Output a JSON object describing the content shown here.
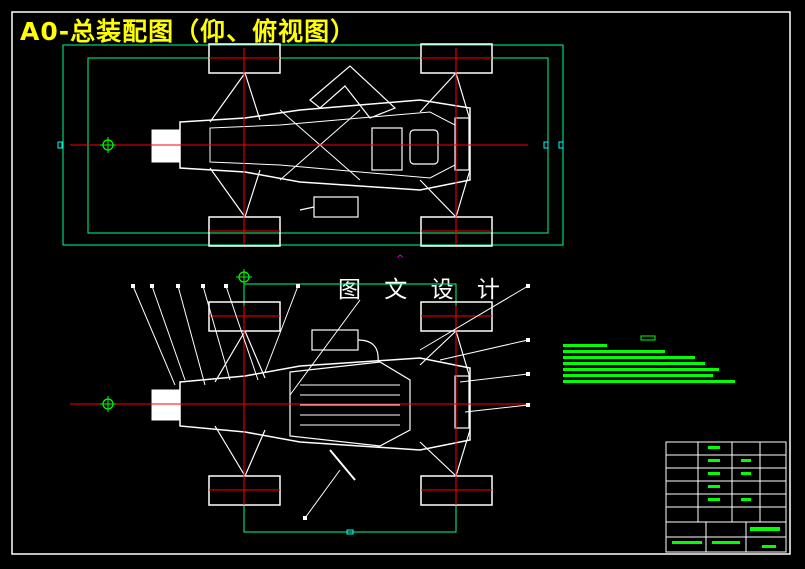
{
  "drawing": {
    "title": "A0-总装配图（仰、俯视图）",
    "watermark": "图 文 设 计",
    "colors": {
      "background": "#000000",
      "frame": "#ffffff",
      "outline": "#00ff00",
      "centerline": "#ff0000",
      "title": "#ffff00",
      "wheel": "#ffffff",
      "dim": "#00ffff",
      "marker": "#ff00ff"
    }
  }
}
